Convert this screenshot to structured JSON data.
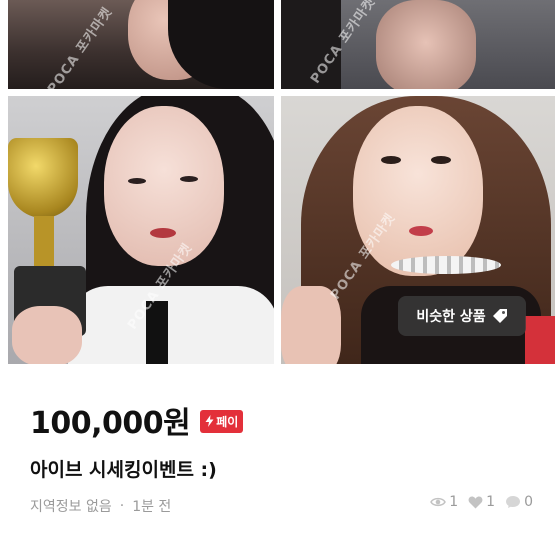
{
  "watermark": {
    "text": "POCA 포카마켓"
  },
  "overlay": {
    "similar_label": "비슷한 상품",
    "icon": "tag-icon"
  },
  "product": {
    "price": "100,000원",
    "pay_badge": "페이",
    "pay_icon": "lightning-icon",
    "title": "아이브 시세킹이벤트 :)",
    "location": "지역정보 없음",
    "separator": "·",
    "time": "1분 전"
  },
  "stats": {
    "views": "1",
    "likes": "1",
    "chats": "0"
  },
  "colors": {
    "badge_red": "#e3303a",
    "meta_gray": "#9b9b9b"
  }
}
